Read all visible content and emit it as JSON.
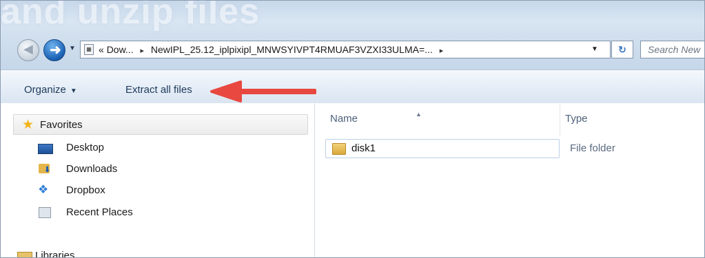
{
  "window": {
    "ghost_title": "and unzip files"
  },
  "nav": {
    "back_icon": "back-arrow",
    "forward_icon": "forward-arrow"
  },
  "address_bar": {
    "overflow": "«",
    "crumbs": [
      "Dow...",
      "NewIPL_25.12_iplpixipl_MNWSYIVPT4RMUAF3VZXI33ULMA=..."
    ],
    "trailing_arrow": "▸"
  },
  "search": {
    "placeholder": "Search New"
  },
  "toolbar": {
    "organize_label": "Organize",
    "extract_label": "Extract all files"
  },
  "navpane": {
    "favorites_label": "Favorites",
    "items": [
      {
        "label": "Desktop",
        "icon": "desktop-icon"
      },
      {
        "label": "Downloads",
        "icon": "downloads-icon"
      },
      {
        "label": "Dropbox",
        "icon": "dropbox-icon"
      },
      {
        "label": "Recent Places",
        "icon": "recent-places-icon"
      }
    ],
    "libraries_label": "Libraries"
  },
  "details": {
    "columns": [
      "Name",
      "Type"
    ],
    "rows": [
      {
        "name": "disk1",
        "type": "File folder"
      }
    ]
  },
  "colors": {
    "accent_arrow": "#e8483f",
    "toolbar_text": "#1e395b"
  }
}
